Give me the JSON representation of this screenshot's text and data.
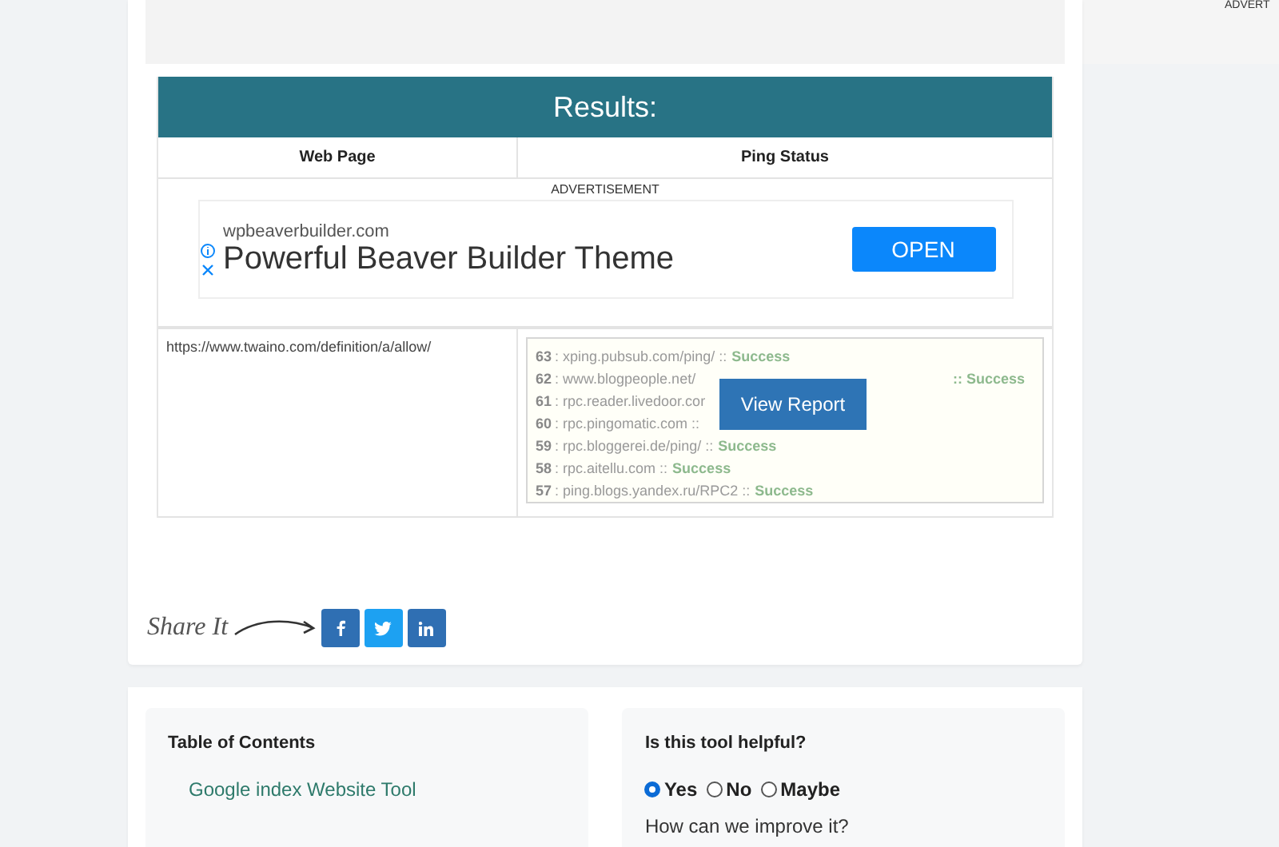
{
  "side_ad_label": "ADVERT",
  "results": {
    "title": "Results:",
    "columns": [
      "Web Page",
      "Ping Status"
    ],
    "ad": {
      "label": "ADVERTISEMENT",
      "domain": "wpbeaverbuilder.com",
      "headline": "Powerful Beaver Builder Theme",
      "button": "OPEN"
    },
    "row": {
      "url": "https://www.twaino.com/definition/a/allow/",
      "pings": [
        {
          "num": "63",
          "text": ": xping.pubsub.com/ping/ ::",
          "status": "Success",
          "gap": false
        },
        {
          "num": "62",
          "text": ": www.blogpeople.net/",
          "status": ":: Success",
          "gap": true
        },
        {
          "num": "61",
          "text": ": rpc.reader.livedoor.cor"
        },
        {
          "num": "60",
          "text": ": rpc.pingomatic.com ::"
        },
        {
          "num": "59",
          "text": ": rpc.bloggerei.de/ping/ ::",
          "status": "Success",
          "gap": false
        },
        {
          "num": "58",
          "text": ": rpc.aitellu.com ::",
          "status": "Success",
          "gap": false
        },
        {
          "num": "57",
          "text": ": ping.blogs.yandex.ru/RPC2 ::",
          "status": "Success",
          "gap": false
        }
      ],
      "report_button": "View Report"
    }
  },
  "share": {
    "label": "Share It",
    "buttons": [
      {
        "kind": "facebook"
      },
      {
        "kind": "twitter"
      },
      {
        "kind": "linkedin"
      }
    ]
  },
  "toc": {
    "title": "Table of Contents",
    "items": [
      "Google index Website Tool"
    ]
  },
  "feedback": {
    "question": "Is this tool helpful?",
    "options": [
      {
        "label": "Yes",
        "selected": true
      },
      {
        "label": "No",
        "selected": false
      },
      {
        "label": "Maybe",
        "selected": false
      }
    ],
    "prompt": "How can we improve it?"
  }
}
